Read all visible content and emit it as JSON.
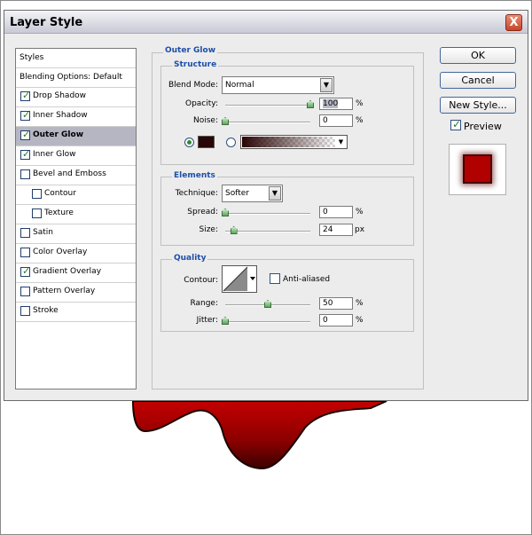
{
  "dialog": {
    "title": "Layer Style",
    "close_label": "X"
  },
  "styles_list": {
    "header": "Styles",
    "blending_options": "Blending Options: Default",
    "items": [
      {
        "label": "Drop Shadow",
        "checked": true,
        "selected": false,
        "indent": false
      },
      {
        "label": "Inner Shadow",
        "checked": true,
        "selected": false,
        "indent": false
      },
      {
        "label": "Outer Glow",
        "checked": true,
        "selected": true,
        "indent": false
      },
      {
        "label": "Inner Glow",
        "checked": true,
        "selected": false,
        "indent": false
      },
      {
        "label": "Bevel and Emboss",
        "checked": false,
        "selected": false,
        "indent": false
      },
      {
        "label": "Contour",
        "checked": false,
        "selected": false,
        "indent": true
      },
      {
        "label": "Texture",
        "checked": false,
        "selected": false,
        "indent": true
      },
      {
        "label": "Satin",
        "checked": false,
        "selected": false,
        "indent": false
      },
      {
        "label": "Color Overlay",
        "checked": false,
        "selected": false,
        "indent": false
      },
      {
        "label": "Gradient Overlay",
        "checked": true,
        "selected": false,
        "indent": false
      },
      {
        "label": "Pattern Overlay",
        "checked": false,
        "selected": false,
        "indent": false
      },
      {
        "label": "Stroke",
        "checked": false,
        "selected": false,
        "indent": false
      }
    ]
  },
  "outer_glow": {
    "title": "Outer Glow",
    "structure": {
      "title": "Structure",
      "blend_mode_label": "Blend Mode:",
      "blend_mode_value": "Normal",
      "opacity_label": "Opacity:",
      "opacity_value": "100",
      "opacity_fraction": 1.0,
      "noise_label": "Noise:",
      "noise_value": "0",
      "noise_fraction": 0.0,
      "percent": "%",
      "glow_color": "#2a0606"
    },
    "elements": {
      "title": "Elements",
      "technique_label": "Technique:",
      "technique_value": "Softer",
      "spread_label": "Spread:",
      "spread_value": "0",
      "spread_fraction": 0.0,
      "size_label": "Size:",
      "size_value": "24",
      "size_fraction": 0.1,
      "percent": "%",
      "px": "px"
    },
    "quality": {
      "title": "Quality",
      "contour_label": "Contour:",
      "anti_aliased_label": "Anti-aliased",
      "range_label": "Range:",
      "range_value": "50",
      "range_fraction": 0.5,
      "jitter_label": "Jitter:",
      "jitter_value": "0",
      "jitter_fraction": 0.0,
      "percent": "%"
    }
  },
  "buttons": {
    "ok": "OK",
    "cancel": "Cancel",
    "new_style": "New Style...",
    "preview": "Preview"
  },
  "colors": {
    "accent": "#1e4fa8",
    "preview_fill": "#b00000",
    "canvas_shape": "#a00000"
  }
}
